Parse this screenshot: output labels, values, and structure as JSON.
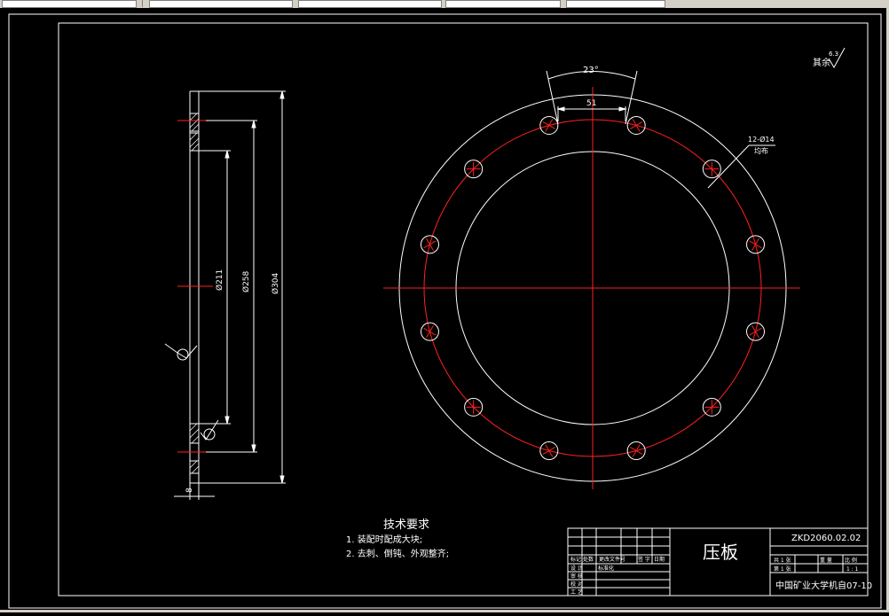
{
  "toolbar": {
    "fields": [
      "",
      "",
      "",
      "",
      ""
    ]
  },
  "drawing": {
    "roughness_label": "其余",
    "roughness_value": "6.3",
    "dims_side": {
      "d1": "Ø211",
      "d2": "Ø258",
      "d3": "Ø304",
      "thickness": "8"
    },
    "dims_front": {
      "angle": "23°",
      "chord": "51",
      "holes": "12-Ø14",
      "holes_note": "均布"
    },
    "tech": {
      "title": "技术要求",
      "items": [
        "1. 装配时配成大块;",
        "2. 去刺、倒钝、外观整齐;"
      ]
    },
    "title_block": {
      "part_name": "压板",
      "drawing_no": "ZKD2060.02.02",
      "sheet_total": "共 1 张",
      "sheet_no": "第 1 张",
      "weight_label": "重 量",
      "scale_label": "比 例",
      "scale_value": "1 : 1",
      "org": "中国矿业大学机自07-10",
      "rev_headers": [
        "标记",
        "处数",
        "更改文件号",
        "签 字",
        "日期"
      ],
      "roles": [
        "设 计",
        "审 核",
        "校 对",
        "工 艺"
      ],
      "std_label": "标准化"
    }
  }
}
